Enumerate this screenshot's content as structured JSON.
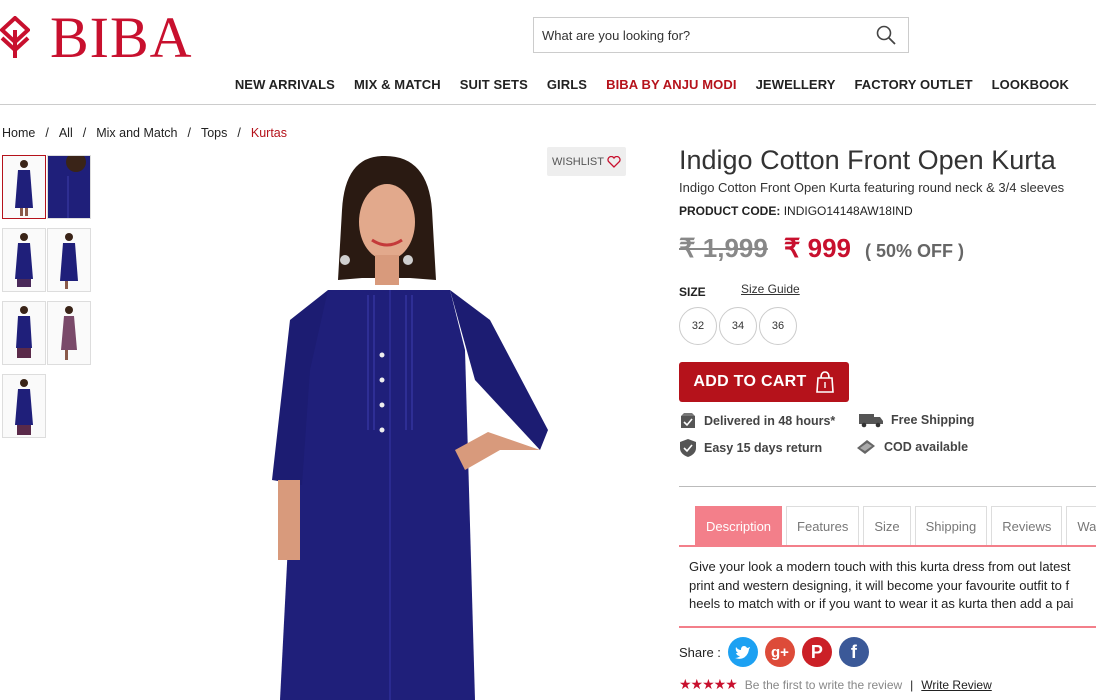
{
  "brand": {
    "name": "BIBA",
    "color": "#c8102e"
  },
  "search": {
    "placeholder": "What are you looking for?",
    "icon": "search-icon"
  },
  "nav": [
    {
      "label": "NEW ARRIVALS"
    },
    {
      "label": "MIX & MATCH"
    },
    {
      "label": "SUIT SETS"
    },
    {
      "label": "GIRLS"
    },
    {
      "label": "BIBA BY ANJU MODI",
      "active": true
    },
    {
      "label": "JEWELLERY"
    },
    {
      "label": "FACTORY OUTLET"
    },
    {
      "label": "LOOKBOOK"
    }
  ],
  "breadcrumb": [
    "Home",
    "All",
    "Mix and Match",
    "Tops",
    "Kurtas"
  ],
  "wishlist": {
    "label": "WISHLIST",
    "icon": "heart-icon"
  },
  "product": {
    "title": "Indigo Cotton Front Open Kurta",
    "subtitle": "Indigo Cotton Front Open Kurta featuring round neck & 3/4 sleeves",
    "code_label": "PRODUCT CODE:",
    "code": "INDIGO14148AW18IND",
    "old_price": "₹ 1,999",
    "price": "₹ 999",
    "discount": "( 50% OFF )",
    "size_label": "SIZE",
    "size_guide": "Size Guide",
    "sizes": [
      "32",
      "34",
      "36"
    ],
    "add_to_cart": "ADD TO CART",
    "kurta_color": "#1f1f7a",
    "accent": "#b5121b"
  },
  "features": [
    {
      "label": "Delivered in 48 hours*",
      "icon": "delivery-box-icon"
    },
    {
      "label": "Free Shipping",
      "icon": "truck-icon"
    },
    {
      "label": "Easy 15 days return",
      "icon": "shield-check-icon"
    },
    {
      "label": "COD available",
      "icon": "cash-icon"
    }
  ],
  "tabs": [
    {
      "label": "Description",
      "active": true
    },
    {
      "label": "Features"
    },
    {
      "label": "Size"
    },
    {
      "label": "Shipping"
    },
    {
      "label": "Reviews"
    },
    {
      "label": "Wa"
    }
  ],
  "description_lines": [
    "Give your look a modern touch with this kurta dress from out latest",
    "print and western designing, it will become your favourite outfit to f",
    "heels to match with or if you want to wear it as kurta then add a pai"
  ],
  "share": {
    "label": "Share :",
    "networks": [
      {
        "icon": "twitter-icon",
        "color": "#1da1f2"
      },
      {
        "icon": "google-plus-icon",
        "color": "#dd4b39"
      },
      {
        "icon": "pinterest-icon",
        "color": "#cb2027"
      },
      {
        "icon": "facebook-icon",
        "color": "#3b5998"
      }
    ]
  },
  "reviews": {
    "rating": 5,
    "prompt": "Be the first to write the review",
    "separator": "|",
    "write": "Write Review"
  }
}
